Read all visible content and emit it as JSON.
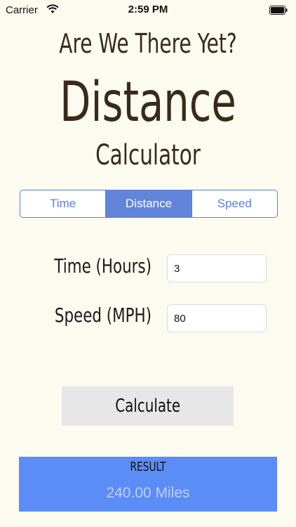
{
  "status_bar": {
    "carrier": "Carrier",
    "time": "2:59 PM",
    "icons": [
      "wifi-icon",
      "battery-icon"
    ]
  },
  "header": {
    "line1": "Are We There Yet?",
    "line2": "Distance",
    "line3": "Calculator"
  },
  "segmented_control": {
    "items": [
      {
        "label": "Time",
        "selected": false
      },
      {
        "label": "Distance",
        "selected": true
      },
      {
        "label": "Speed",
        "selected": false
      }
    ]
  },
  "form": {
    "time_label": "Time (Hours)",
    "time_value": "3",
    "speed_label": "Speed (MPH)",
    "speed_value": "80"
  },
  "calculate_button": {
    "label": "Calculate"
  },
  "result": {
    "title": "RESULT",
    "value": "240.00 Miles"
  },
  "colors": {
    "background": "#fcfbef",
    "accent": "#5c7fd6",
    "selected_segment": "#6285db",
    "result_background": "#5c8df6",
    "header_text": "#3a2a1a"
  }
}
